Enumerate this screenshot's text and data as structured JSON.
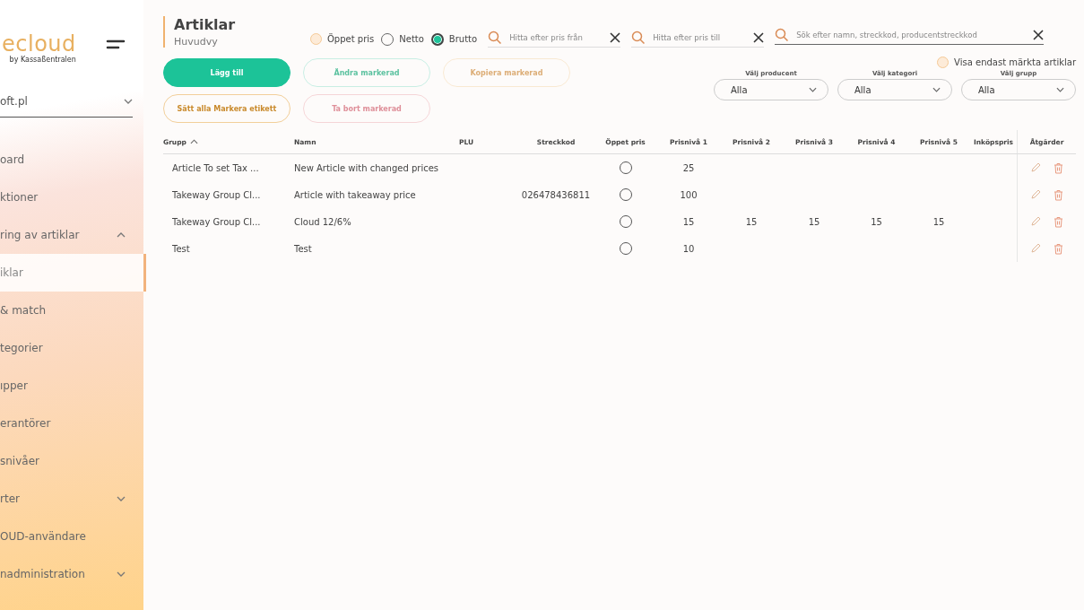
{
  "sidebar": {
    "logo": "ecloud",
    "logo_sub": "by Kassaßentralen",
    "company_select": {
      "value": "oft.pl"
    },
    "items": [
      {
        "label": "oard",
        "selected": false
      },
      {
        "label": "ktioner",
        "selected": false
      },
      {
        "label": "ring av artiklar",
        "expanded": true,
        "selected": false
      },
      {
        "label": "iklar",
        "selected": true
      },
      {
        "label": "& match",
        "selected": false
      },
      {
        "label": "tegorier",
        "selected": false
      },
      {
        "label": "ıpper",
        "selected": false
      },
      {
        "label": "erantörer",
        "selected": false
      },
      {
        "label": "snivåer",
        "selected": false
      },
      {
        "label": "rter",
        "expanded": false,
        "selected": false
      },
      {
        "label": "OUD-användare",
        "selected": false
      },
      {
        "label": "nadministration",
        "expanded": false,
        "selected": false
      }
    ]
  },
  "header": {
    "title": "Artiklar",
    "subtitle": "Huvudvy"
  },
  "price_options": [
    {
      "label": "Öppet pris",
      "kind": "checkbox",
      "selected": false
    },
    {
      "label": "Netto",
      "kind": "radio",
      "selected": false
    },
    {
      "label": "Brutto",
      "kind": "radio",
      "selected": true
    }
  ],
  "search_fields": [
    {
      "placeholder": "Hitta efter pris från"
    },
    {
      "placeholder": "Hitta efter pris till"
    },
    {
      "placeholder": "Sök efter namn, streckkod, producentstreckkod"
    }
  ],
  "buttons": [
    {
      "label": "Lägg till",
      "kind": "primary",
      "disabled": false
    },
    {
      "label": "Ändra markerad",
      "kind": "outline-green",
      "disabled": true
    },
    {
      "label": "Kopiera markerad",
      "kind": "outline-orange",
      "disabled": true
    },
    {
      "label": "Sätt alla Markera etikett",
      "kind": "outline-orange",
      "disabled": false
    },
    {
      "label": "Ta bort markerad",
      "kind": "outline-pink",
      "disabled": true
    }
  ],
  "only_marked": {
    "label": "Visa endast märkta artiklar",
    "checked": false
  },
  "filters": [
    {
      "label": "Välj producent",
      "value": "Alla"
    },
    {
      "label": "Välj kategori",
      "value": "Alla"
    },
    {
      "label": "Välj grupp",
      "value": "Alla"
    }
  ],
  "table": {
    "columns": [
      {
        "label": "Grupp",
        "sorted": true
      },
      {
        "label": "Namn",
        "sorted": false
      },
      {
        "label": "PLU",
        "sorted": false
      },
      {
        "label": "Streckkod",
        "sorted": false
      },
      {
        "label": "Öppet pris",
        "sorted": false
      },
      {
        "label": "Prisnivå 1",
        "sorted": false
      },
      {
        "label": "Prisnivå 2",
        "sorted": false
      },
      {
        "label": "Prisnivå 3",
        "sorted": false
      },
      {
        "label": "Prisnivå 4",
        "sorted": false
      },
      {
        "label": "Prisnivå 5",
        "sorted": false
      },
      {
        "label": "Inköpspris",
        "sorted": false
      },
      {
        "label": "Åtgärder",
        "sorted": false
      }
    ],
    "rows": [
      {
        "group": "Article To set Tax ...",
        "name": "New Article with changed prices",
        "open_price": false,
        "price_1": "25"
      },
      {
        "group": "Takeway Group Cl...",
        "name": "Article with takeaway price",
        "barcode": "026478436811",
        "open_price": false,
        "price_1": "100"
      },
      {
        "group": "Takeway Group Cl...",
        "name": "Cloud 12/6%",
        "open_price": false,
        "price_1": "15",
        "price_2": "15",
        "price_3": "15",
        "price_4": "15",
        "price_5": "15"
      },
      {
        "group": "Test",
        "name": "Test",
        "open_price": false,
        "price_1": "10"
      }
    ]
  }
}
